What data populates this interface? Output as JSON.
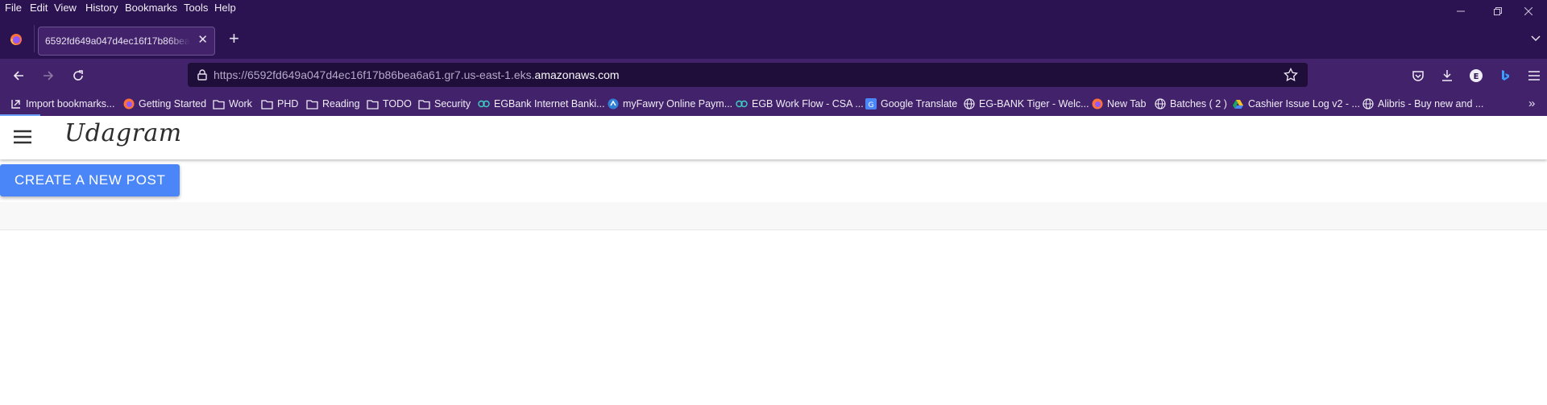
{
  "menu": [
    "File",
    "Edit",
    "View",
    "History",
    "Bookmarks",
    "Tools",
    "Help"
  ],
  "tab": {
    "title": "6592fd649a047d4ec16f17b86bea6a61"
  },
  "url": {
    "prefix": "https://6592fd649a047d4ec16f17b86bea6a61.gr7.us-east-1.eks.",
    "domain": "amazonaws.com"
  },
  "bookmarks": [
    {
      "label": "Import bookmarks...",
      "icon": "import-icon"
    },
    {
      "label": "Getting Started",
      "icon": "firefox-icon"
    },
    {
      "label": "Work",
      "icon": "folder-icon"
    },
    {
      "label": "PHD",
      "icon": "folder-icon"
    },
    {
      "label": "Reading",
      "icon": "folder-icon"
    },
    {
      "label": "TODO",
      "icon": "folder-icon"
    },
    {
      "label": "Security",
      "icon": "folder-icon"
    },
    {
      "label": "EGBank Internet Banki...",
      "icon": "link-icon"
    },
    {
      "label": "myFawry Online Paym...",
      "icon": "fawry-icon"
    },
    {
      "label": "EGB Work Flow - CSA ...",
      "icon": "link-icon"
    },
    {
      "label": "Google Translate",
      "icon": "translate-icon"
    },
    {
      "label": "EG-BANK Tiger - Welc...",
      "icon": "globe-icon"
    },
    {
      "label": "New Tab",
      "icon": "firefox-icon"
    },
    {
      "label": "Batches ( 2 )",
      "icon": "globe-icon"
    },
    {
      "label": "Cashier Issue Log v2 - ...",
      "icon": "drive-icon"
    },
    {
      "label": "Alibris - Buy new and ...",
      "icon": "globe-icon"
    }
  ],
  "app": {
    "brand": "Udagram",
    "create_button": "CREATE A NEW POST"
  },
  "colors": {
    "chrome": "#2b1250",
    "toolbar": "#42226b",
    "primary_button": "#4a86f7"
  }
}
